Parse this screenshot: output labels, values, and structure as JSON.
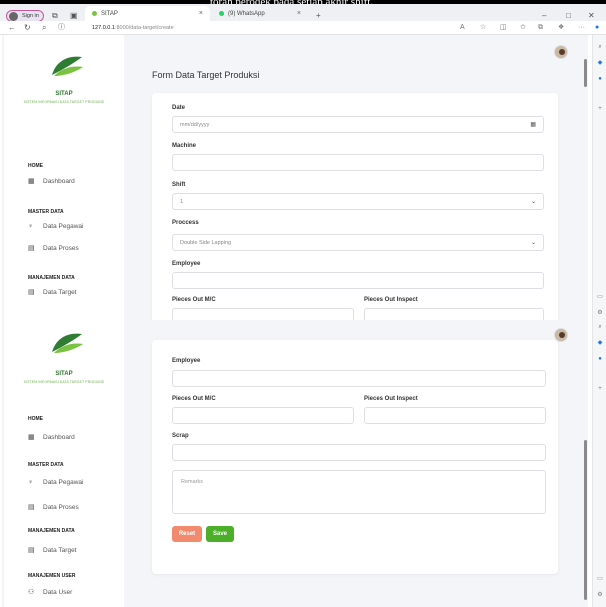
{
  "top_strip_text": "torah perodek pada setiap akhir shift.",
  "browser": {
    "signin_label": "Sign in",
    "tabs": [
      {
        "title": "SITAP",
        "close": "×"
      },
      {
        "title": "(9) WhatsApp",
        "close": "×"
      }
    ],
    "new_tab": "+",
    "window_controls": {
      "minimize": "–",
      "maximize": "□",
      "close": "✕"
    },
    "url_host": "127.0.0.1",
    "url_path": ":8000/data-target/create"
  },
  "brand": {
    "name": "SITAP",
    "tagline": "SISTEM INFORMASI DATA TARGET PRODUKSI",
    "colors": {
      "leaf_dark": "#2e7d32",
      "leaf_light": "#7cc242"
    }
  },
  "sidebar": {
    "sections": [
      {
        "title": "HOME",
        "items": [
          {
            "label": "Dashboard",
            "icon": "dashboard-icon"
          }
        ]
      },
      {
        "title": "MASTER DATA",
        "items": [
          {
            "label": "Data Pegawai",
            "icon": "person-icon"
          },
          {
            "label": "Data Proses",
            "icon": "table-icon"
          }
        ]
      },
      {
        "title": "MANAJEMEN DATA",
        "items": [
          {
            "label": "Data Target",
            "icon": "table-icon"
          }
        ]
      },
      {
        "title": "MANAJEMEN USER",
        "items": [
          {
            "label": "Data User",
            "icon": "users-icon"
          }
        ]
      }
    ]
  },
  "form": {
    "title": "Form Data Target Produksi",
    "date_label": "Date",
    "date_placeholder": "mm/dd/yyyy",
    "machine_label": "Machine",
    "machine_value": "",
    "shift_label": "Shift",
    "shift_value": "1",
    "process_label": "Proccess",
    "process_value": "Double Side Lapping",
    "employee_label": "Employee",
    "employee_value": "",
    "pieces_out_mc_label": "Pieces Out M/C",
    "pieces_out_inspect_label": "Pieces Out Inspect",
    "scrap_label": "Scrap",
    "remarks_placeholder": "Remarks",
    "reset_label": "Reset",
    "save_label": "Save",
    "colors": {
      "reset": "#f28b6e",
      "save": "#4caf2a"
    }
  }
}
